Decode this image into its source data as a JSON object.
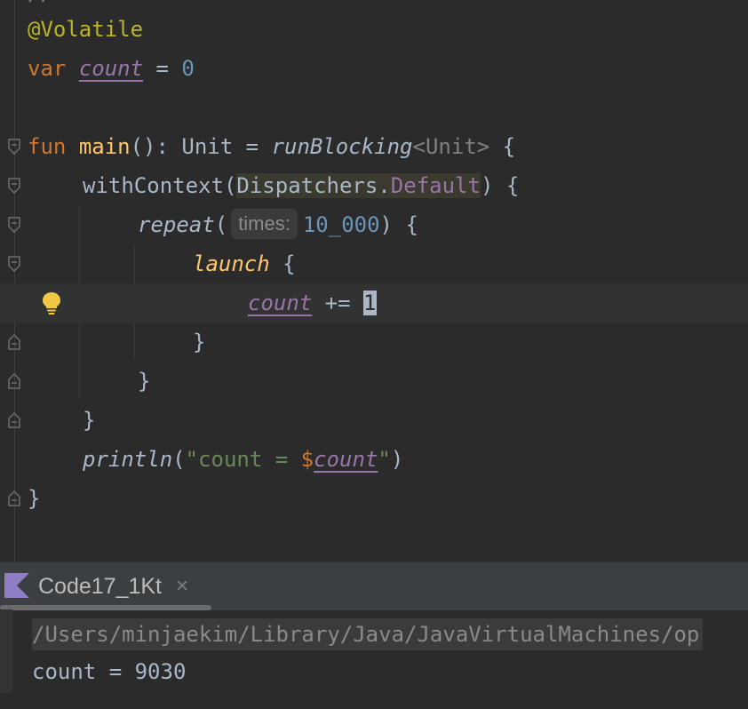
{
  "editor": {
    "annotation": "@Volatile",
    "var_keyword": "var",
    "var_name": "count",
    "var_assign": " = ",
    "var_value": "0",
    "fun_keyword": "fun",
    "fun_name": "main",
    "fun_sig": "(): Unit = ",
    "run_blocking": "runBlocking",
    "type_param": "<Unit>",
    "open_brace": " {",
    "with_context": "withContext(",
    "dispatchers": "Dispatchers",
    "dot": ".",
    "default_field": "Default",
    "close_paren_brace": ") {",
    "repeat": "repeat",
    "paren_open": "(",
    "hint_times": "times:",
    "repeat_count": "10_000",
    "launch": "launch",
    "brace_only": "{",
    "increment_var": "count",
    "increment_op": " += ",
    "increment_value": "1",
    "close_brace": "}",
    "println": "println",
    "str_open": "\"count = ",
    "str_dollar": "$",
    "str_var": "count",
    "str_close": "\"",
    "paren_close": ")"
  },
  "run_panel": {
    "tab_title": "Code17_1Kt",
    "close_symbol": "×",
    "command": "/Users/minjaekim/Library/Java/JavaVirtualMachines/op",
    "output": "count = 9030"
  },
  "colors": {
    "background": "#2b2b2b",
    "keyword": "#cc7832",
    "annotation": "#bbb529",
    "property": "#9876aa",
    "number": "#6897bb",
    "function": "#ffc66d",
    "string": "#6a8759",
    "bulb": "#f2c744"
  },
  "icons": {
    "fold": "fold-marker-icon",
    "bulb": "lightbulb-icon",
    "kotlin": "kotlin-logo-icon",
    "close": "close-icon"
  }
}
